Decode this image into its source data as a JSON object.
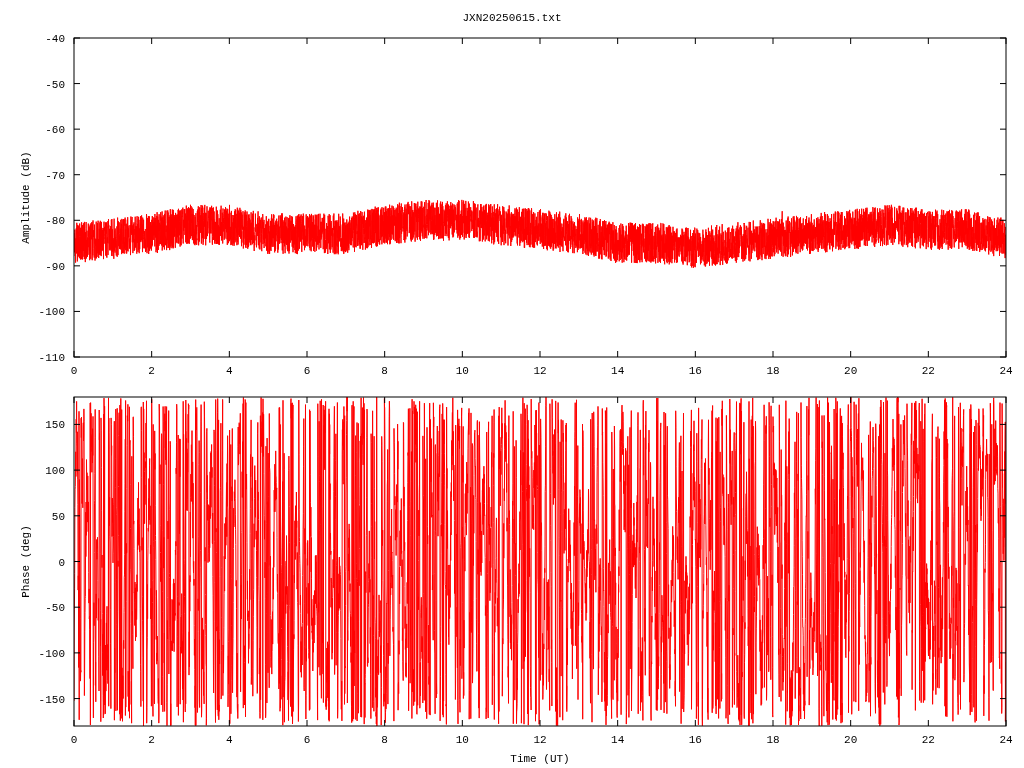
{
  "title": "JXN20250615.txt",
  "plots": [
    {
      "kind": "amplitude",
      "ylabel": "Amplitude (dB)",
      "yticks": [
        "-40",
        "-50",
        "-60",
        "-70",
        "-80",
        "-90",
        "-100",
        "-110"
      ],
      "xticks": [
        "0",
        "2",
        "4",
        "6",
        "8",
        "10",
        "12",
        "14",
        "16",
        "18",
        "20",
        "22",
        "24"
      ]
    },
    {
      "kind": "phase",
      "ylabel": "Phase (deg)",
      "xlabel": "Time (UT)",
      "yticks": [
        "150",
        "100",
        "50",
        "0",
        "-50",
        "-100",
        "-150"
      ],
      "xticks": [
        "0",
        "2",
        "4",
        "6",
        "8",
        "10",
        "12",
        "14",
        "16",
        "18",
        "20",
        "22",
        "24"
      ]
    }
  ]
}
